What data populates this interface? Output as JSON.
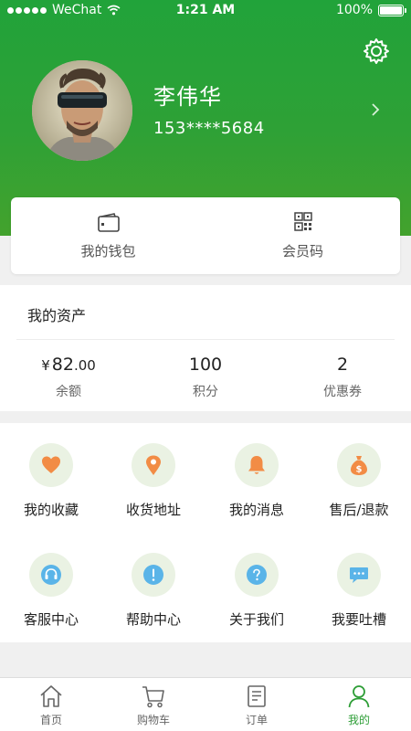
{
  "status_bar": {
    "carrier": "WeChat",
    "time": "1:21 AM",
    "battery": "100%"
  },
  "profile": {
    "name": "李伟华",
    "phone": "153****5684"
  },
  "quick_actions": [
    {
      "label": "我的钱包",
      "icon": "wallet-icon"
    },
    {
      "label": "会员码",
      "icon": "qr-code-icon"
    }
  ],
  "assets": {
    "title": "我的资产",
    "items": [
      {
        "currency": "¥",
        "value": "82",
        "decimals": ".00",
        "label": "余额"
      },
      {
        "value": "100",
        "label": "积分"
      },
      {
        "value": "2",
        "label": "优惠券"
      }
    ]
  },
  "services": [
    {
      "label": "我的收藏",
      "icon": "heart-icon"
    },
    {
      "label": "收货地址",
      "icon": "location-pin-icon"
    },
    {
      "label": "我的消息",
      "icon": "bell-icon"
    },
    {
      "label": "售后/退款",
      "icon": "money-bag-icon"
    },
    {
      "label": "客服中心",
      "icon": "headset-icon"
    },
    {
      "label": "帮助中心",
      "icon": "exclamation-icon"
    },
    {
      "label": "关于我们",
      "icon": "question-icon"
    },
    {
      "label": "我要吐槽",
      "icon": "chat-bubble-icon"
    }
  ],
  "tabs": [
    {
      "label": "首页",
      "icon": "home-icon",
      "active": false
    },
    {
      "label": "购物车",
      "icon": "cart-icon",
      "active": false
    },
    {
      "label": "订单",
      "icon": "order-icon",
      "active": false
    },
    {
      "label": "我的",
      "icon": "user-icon",
      "active": true
    }
  ],
  "colors": {
    "header_green": "#2ea136",
    "accent_orange": "#f28c45",
    "accent_blue": "#5ab4e8",
    "icon_circle_bg": "#eaf2e3",
    "active_tab": "#2e9e37"
  }
}
